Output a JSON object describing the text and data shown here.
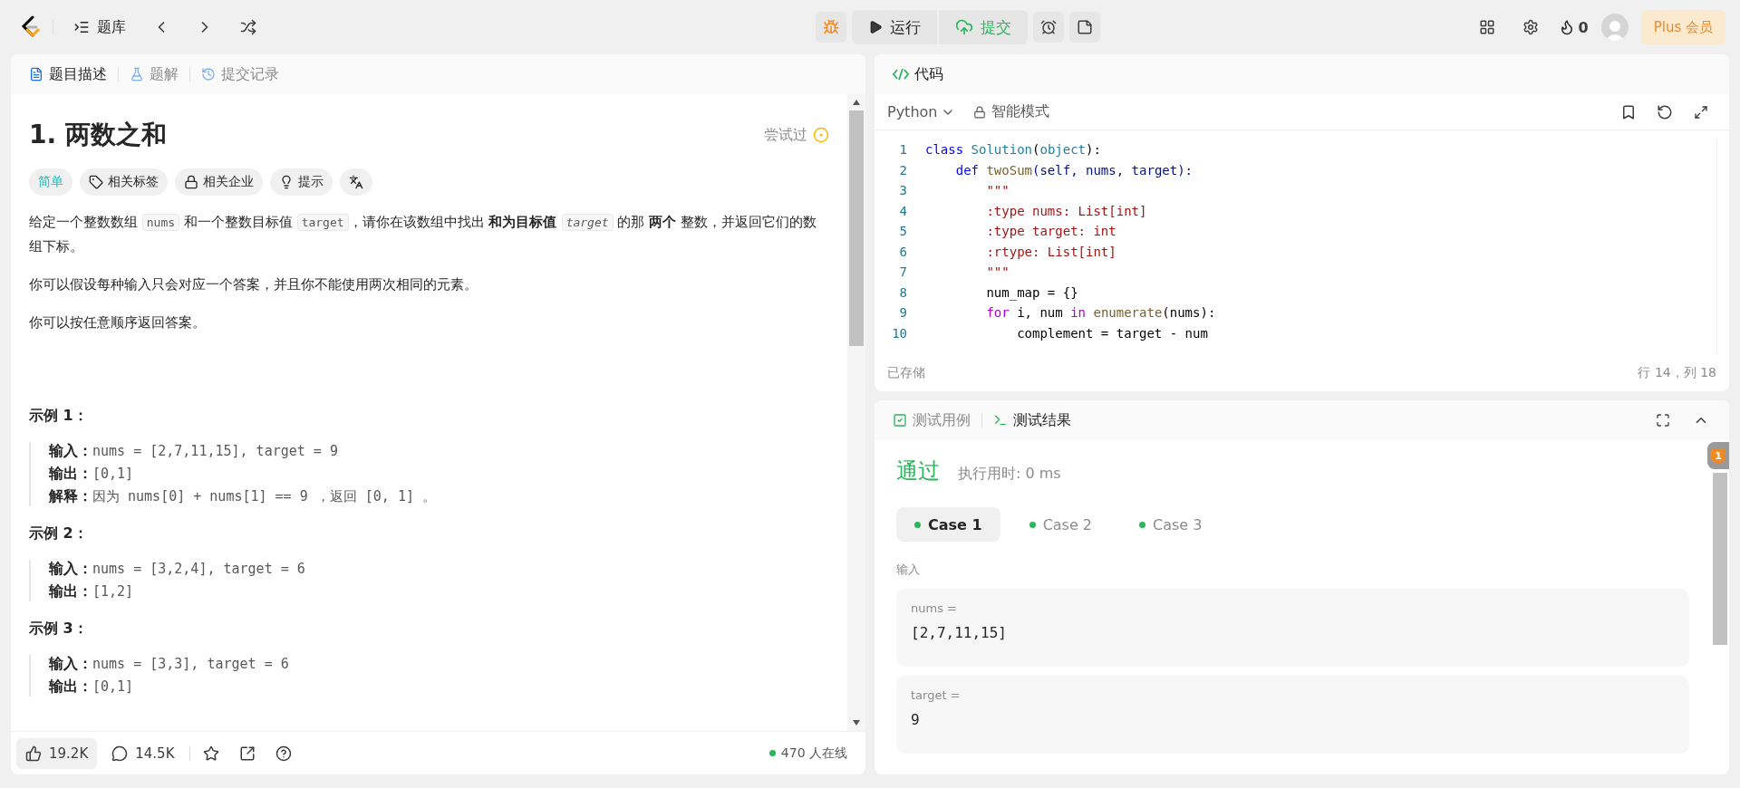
{
  "topbar": {
    "nav_label": "题库",
    "run_label": "运行",
    "submit_label": "提交",
    "streak": "0",
    "plus_label": "Plus 会员"
  },
  "problem_panel": {
    "tabs": [
      {
        "label": "题目描述",
        "selected": true
      },
      {
        "label": "题解",
        "selected": false
      },
      {
        "label": "提交记录",
        "selected": false
      }
    ],
    "title": "1. 两数之和",
    "status": "尝试过",
    "tags": [
      {
        "kind": "difficulty",
        "label": "简单"
      },
      {
        "kind": "tag",
        "label": "相关标签"
      },
      {
        "kind": "lock",
        "label": "相关企业"
      },
      {
        "kind": "hint",
        "label": "提示"
      },
      {
        "kind": "translate"
      }
    ],
    "paragraphs": [
      [
        {
          "kind": "text",
          "text": "给定一个整数数组 "
        },
        {
          "kind": "code",
          "text": "nums"
        },
        {
          "kind": "text",
          "text": " 和一个整数目标值 "
        },
        {
          "kind": "code",
          "text": "target"
        },
        {
          "kind": "text",
          "text": "，请你在该数组中找出 "
        },
        {
          "kind": "bold",
          "text": "和为目标值 "
        },
        {
          "kind": "code_italic",
          "text": "target"
        },
        {
          "kind": "text",
          "text": "  的那 "
        },
        {
          "kind": "bold",
          "text": "两个"
        },
        {
          "kind": "text",
          "text": " 整数，并返回它们的数组下标。"
        }
      ],
      [
        {
          "kind": "text",
          "text": "你可以假设每种输入只会对应一个答案，并且你不能使用两次相同的元素。"
        }
      ],
      [
        {
          "kind": "text",
          "text": "你可以按任意顺序返回答案。"
        }
      ]
    ],
    "examples": [
      {
        "title": "示例 1：",
        "lines": [
          {
            "label": "输入：",
            "value": "nums = [2,7,11,15], target = 9"
          },
          {
            "label": "输出：",
            "value": "[0,1]"
          },
          {
            "label": "解释：",
            "value": "因为 nums[0] + nums[1] == 9 ，返回 [0, 1] 。"
          }
        ]
      },
      {
        "title": "示例 2：",
        "lines": [
          {
            "label": "输入：",
            "value": "nums = [3,2,4], target = 6"
          },
          {
            "label": "输出：",
            "value": "[1,2]"
          }
        ]
      },
      {
        "title": "示例 3：",
        "lines": [
          {
            "label": "输入：",
            "value": "nums = [3,3], target = 6"
          },
          {
            "label": "输出：",
            "value": "[0,1]"
          }
        ]
      }
    ],
    "footer": {
      "likes": "19.2K",
      "comments": "14.5K",
      "online": "470 人在线"
    }
  },
  "code_panel": {
    "title": "代码",
    "language": "Python",
    "mode": "智能模式",
    "lines": [
      {
        "number": "1",
        "tokens": [
          {
            "kind": "keyword",
            "text": "class "
          },
          {
            "kind": "class",
            "text": "Solution"
          },
          {
            "kind": "plain",
            "text": "("
          },
          {
            "kind": "class",
            "text": "object"
          },
          {
            "kind": "plain",
            "text": "):"
          }
        ]
      },
      {
        "number": "2",
        "tokens": [
          {
            "kind": "keyword",
            "text": "    def "
          },
          {
            "kind": "func",
            "text": "twoSum"
          },
          {
            "kind": "param",
            "text": "(self, nums, target):"
          }
        ]
      },
      {
        "number": "3",
        "tokens": [
          {
            "kind": "string",
            "text": "        \"\"\""
          }
        ]
      },
      {
        "number": "4",
        "tokens": [
          {
            "kind": "string",
            "text": "        :type nums: List[int]"
          }
        ]
      },
      {
        "number": "5",
        "tokens": [
          {
            "kind": "string",
            "text": "        :type target: int"
          }
        ]
      },
      {
        "number": "6",
        "tokens": [
          {
            "kind": "string",
            "text": "        :rtype: List[int]"
          }
        ]
      },
      {
        "number": "7",
        "tokens": [
          {
            "kind": "string",
            "text": "        \"\"\""
          }
        ]
      },
      {
        "number": "8",
        "tokens": [
          {
            "kind": "plain",
            "text": "        num_map = {}"
          }
        ]
      },
      {
        "number": "9",
        "tokens": [
          {
            "kind": "control",
            "text": "        for "
          },
          {
            "kind": "plain",
            "text": "i, num "
          },
          {
            "kind": "control",
            "text": "in "
          },
          {
            "kind": "func",
            "text": "enumerate"
          },
          {
            "kind": "plain",
            "text": "(nums):"
          }
        ]
      },
      {
        "number": "10",
        "tokens": [
          {
            "kind": "plain",
            "text": "            complement = target - num"
          }
        ]
      }
    ],
    "saved": "已存储",
    "cursor": "行 14，列 18"
  },
  "test_panel": {
    "tabs": [
      {
        "label": "测试用例",
        "selected": false
      },
      {
        "label": "测试结果",
        "selected": true
      }
    ],
    "verdict": "通过",
    "runtime": "执行用时: 0 ms",
    "cases": [
      {
        "label": "Case 1",
        "selected": true
      },
      {
        "label": "Case 2",
        "selected": false
      },
      {
        "label": "Case 3",
        "selected": false
      }
    ],
    "input_label": "输入",
    "inputs": [
      {
        "name": "nums =",
        "value": "[2,7,11,15]"
      },
      {
        "name": "target =",
        "value": "9"
      }
    ],
    "badge": "1"
  }
}
